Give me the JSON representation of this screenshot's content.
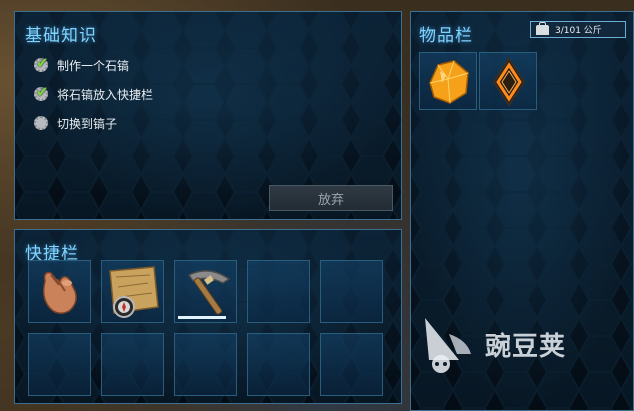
{
  "basics": {
    "title": "基础知识",
    "tasks": [
      {
        "label": "制作一个石镐",
        "done": true
      },
      {
        "label": "将石镐放入快捷栏",
        "done": true
      },
      {
        "label": "切换到镐子",
        "done": false
      }
    ],
    "abandon_label": "放弃"
  },
  "hotbar": {
    "title": "快捷栏",
    "slots": [
      {
        "item": "hand-icon"
      },
      {
        "item": "map-compass-icon"
      },
      {
        "item": "stone-pickaxe-icon",
        "durability": 0.85
      },
      {
        "item": null
      },
      {
        "item": null
      },
      {
        "item": null
      },
      {
        "item": null
      },
      {
        "item": null
      },
      {
        "item": null
      },
      {
        "item": null
      }
    ]
  },
  "inventory": {
    "title": "物品栏",
    "weight": "3/101 公斤",
    "items": [
      {
        "item": "amber-crystal-icon"
      },
      {
        "item": "orange-diamond-implant-icon"
      }
    ]
  },
  "watermark": {
    "text": "豌豆荚",
    "icon": "wandoujia-logo-icon"
  },
  "colors": {
    "title": "#7fd4ff",
    "border": "#3f6f8f",
    "check": "#7bd63a",
    "amber": "#f5a21a"
  }
}
